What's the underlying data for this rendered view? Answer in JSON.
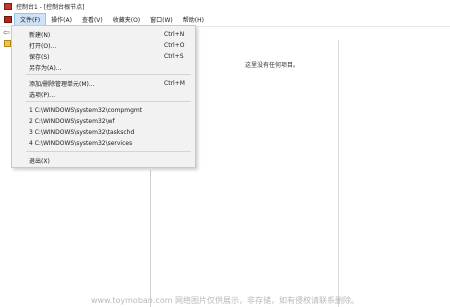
{
  "titlebar": {
    "title": "控制台1 - [控制台根节点]"
  },
  "menubar": {
    "items": [
      {
        "label": "文件(F)"
      },
      {
        "label": "操作(A)"
      },
      {
        "label": "查看(V)"
      },
      {
        "label": "收藏夹(O)"
      },
      {
        "label": "窗口(W)"
      },
      {
        "label": "帮助(H)"
      }
    ]
  },
  "main": {
    "empty_message": "这里没有任何项目。"
  },
  "file_menu": {
    "items": [
      {
        "label": "新建(N)",
        "shortcut": "Ctrl+N"
      },
      {
        "label": "打开(O)...",
        "shortcut": "Ctrl+O"
      },
      {
        "label": "保存(S)",
        "shortcut": "Ctrl+S"
      },
      {
        "label": "另存为(A)...",
        "shortcut": ""
      },
      {
        "label": "添加/删除管理单元(M)...",
        "shortcut": "Ctrl+M"
      },
      {
        "label": "选项(P)...",
        "shortcut": ""
      },
      {
        "label": "1 C:\\WINDOWS\\system32\\compmgmt",
        "shortcut": ""
      },
      {
        "label": "2 C:\\WINDOWS\\system32\\wf",
        "shortcut": ""
      },
      {
        "label": "3 C:\\WINDOWS\\system32\\taskschd",
        "shortcut": ""
      },
      {
        "label": "4 C:\\WINDOWS\\system32\\services",
        "shortcut": ""
      },
      {
        "label": "退出(X)",
        "shortcut": ""
      }
    ]
  },
  "watermark": {
    "text": "www.toymoban.com 网络图片仅供展示，非存储，如有侵权请联系删除。"
  },
  "colors": {
    "menu_active": "#cfe3f8",
    "dropdown_bg": "#f2f2f2"
  },
  "icons": [
    "app-icon",
    "back-arrow-icon",
    "folder-icon"
  ]
}
